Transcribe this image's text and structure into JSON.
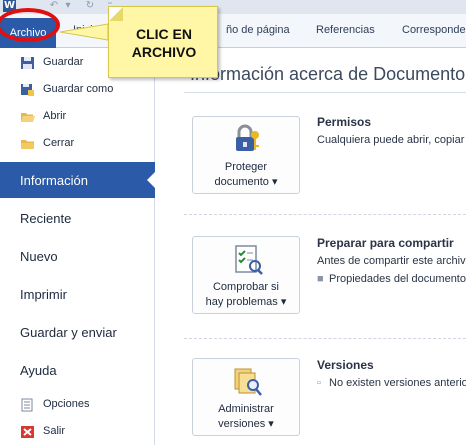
{
  "ribbon": {
    "word_icon": "W",
    "tabs": [
      {
        "label": "Archivo"
      },
      {
        "label": "Inicio"
      },
      {
        "label": "ño de página"
      },
      {
        "label": "Referencias"
      },
      {
        "label": "Correspondencia"
      }
    ]
  },
  "callout": {
    "line1": "CLIC EN",
    "line2": "ARCHIVO"
  },
  "sidebar": {
    "small_items": [
      {
        "label": "Guardar",
        "icon": "save-icon"
      },
      {
        "label": "Guardar como",
        "icon": "save-as-icon"
      },
      {
        "label": "Abrir",
        "icon": "open-folder-icon"
      },
      {
        "label": "Cerrar",
        "icon": "close-folder-icon"
      }
    ],
    "main_items": [
      {
        "label": "Información",
        "selected": true
      },
      {
        "label": "Reciente"
      },
      {
        "label": "Nuevo"
      },
      {
        "label": "Imprimir"
      },
      {
        "label": "Guardar y enviar"
      },
      {
        "label": "Ayuda"
      }
    ],
    "bottom_items": [
      {
        "label": "Opciones",
        "icon": "options-icon"
      },
      {
        "label": "Salir",
        "icon": "exit-icon"
      }
    ]
  },
  "main": {
    "title": "Información acerca de Documento",
    "sections": [
      {
        "button_l1": "Proteger",
        "button_l2": "documento ▾",
        "icon": "lock-key-icon",
        "title": "Permisos",
        "desc": "Cualquiera puede abrir, copiar"
      },
      {
        "button_l1": "Comprobar si",
        "button_l2": "hay problemas ▾",
        "icon": "checklist-icon",
        "title": "Preparar para compartir",
        "desc": "Antes de compartir este archivo",
        "item": "Propiedades del documento"
      },
      {
        "button_l1": "Administrar",
        "button_l2": "versiones ▾",
        "icon": "versions-icon",
        "title": "Versiones",
        "item": "No existen versiones anteriores"
      }
    ]
  },
  "colors": {
    "accent": "#2a5aa8",
    "highlight": "#e01010",
    "note": "#fff7a6"
  }
}
